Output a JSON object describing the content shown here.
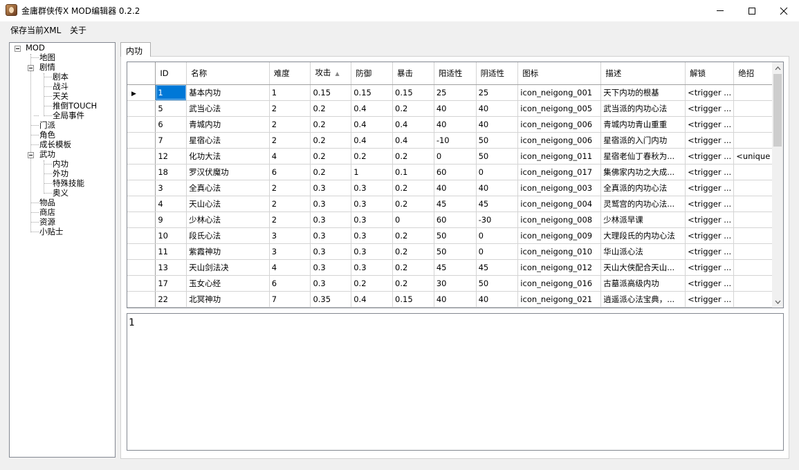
{
  "window": {
    "title": "金庸群侠传X MOD编辑器 0.2.2"
  },
  "menu": {
    "save": "保存当前XML",
    "about": "关于"
  },
  "tree": {
    "root": "MOD",
    "map": "地图",
    "story": "剧情",
    "script": "剧本",
    "battle": "战斗",
    "tower": "天关",
    "touch": "推倒TOUCH",
    "global_event": "全局事件",
    "sect": "门派",
    "role": "角色",
    "growth": "成长模板",
    "martial": "武功",
    "internal": "内功",
    "external": "外功",
    "special": "特殊技能",
    "secret": "奥义",
    "items": "物品",
    "shop": "商店",
    "resource": "资源",
    "tips": "小贴士"
  },
  "tab": {
    "label": "内功"
  },
  "grid": {
    "columns": [
      "ID",
      "名称",
      "难度",
      "攻击",
      "防御",
      "暴击",
      "阳适性",
      "阴适性",
      "图标",
      "描述",
      "解锁",
      "绝招"
    ],
    "rows": [
      [
        "1",
        "基本内功",
        "1",
        "0.15",
        "0.15",
        "0.15",
        "25",
        "25",
        "icon_neigong_001",
        "天下内功的根基",
        "<trigger ...",
        ""
      ],
      [
        "5",
        "武当心法",
        "2",
        "0.2",
        "0.4",
        "0.2",
        "40",
        "40",
        "icon_neigong_005",
        "武当派的内功心法",
        "<trigger ...",
        ""
      ],
      [
        "6",
        "青城内功",
        "2",
        "0.2",
        "0.4",
        "0.4",
        "40",
        "40",
        "icon_neigong_006",
        "青城内功青山重重",
        "<trigger ...",
        ""
      ],
      [
        "7",
        "星宿心法",
        "2",
        "0.2",
        "0.4",
        "0.4",
        "-10",
        "50",
        "icon_neigong_006",
        "星宿派的入门内功",
        "<trigger ...",
        ""
      ],
      [
        "12",
        "化功大法",
        "4",
        "0.2",
        "0.2",
        "0.2",
        "0",
        "50",
        "icon_neigong_011",
        "星宿老仙丁春秋为...",
        "<trigger ...",
        "<unique ..."
      ],
      [
        "18",
        "罗汉伏魔功",
        "6",
        "0.2",
        "1",
        "0.1",
        "60",
        "0",
        "icon_neigong_017",
        "集佛家内功之大成...",
        "<trigger ...",
        ""
      ],
      [
        "3",
        "全真心法",
        "2",
        "0.3",
        "0.3",
        "0.2",
        "40",
        "40",
        "icon_neigong_003",
        "全真派的内功心法",
        "<trigger ...",
        ""
      ],
      [
        "4",
        "天山心法",
        "2",
        "0.3",
        "0.3",
        "0.2",
        "45",
        "45",
        "icon_neigong_004",
        "灵鹫宫的内功心法...",
        "<trigger ...",
        ""
      ],
      [
        "9",
        "少林心法",
        "2",
        "0.3",
        "0.3",
        "0",
        "60",
        "-30",
        "icon_neigong_008",
        "少林派早课",
        "<trigger ...",
        ""
      ],
      [
        "10",
        "段氏心法",
        "3",
        "0.3",
        "0.3",
        "0.2",
        "50",
        "0",
        "icon_neigong_009",
        "大理段氏的内功心法",
        "<trigger ...",
        ""
      ],
      [
        "11",
        "紫霞神功",
        "3",
        "0.3",
        "0.3",
        "0.2",
        "50",
        "0",
        "icon_neigong_010",
        "华山派心法",
        "<trigger ...",
        ""
      ],
      [
        "13",
        "天山剑法决",
        "4",
        "0.3",
        "0.3",
        "0.2",
        "45",
        "45",
        "icon_neigong_012",
        "天山大侠配合天山...",
        "<trigger ...",
        ""
      ],
      [
        "17",
        "玉女心经",
        "6",
        "0.3",
        "0.2",
        "0.2",
        "30",
        "50",
        "icon_neigong_016",
        "古墓派高级内功",
        "<trigger ...",
        ""
      ],
      [
        "22",
        "北冥神功",
        "7",
        "0.35",
        "0.4",
        "0.15",
        "40",
        "40",
        "icon_neigong_021",
        "逍遥派心法宝典，...",
        "<trigger ...",
        ""
      ]
    ]
  },
  "editor": {
    "value": "1"
  }
}
